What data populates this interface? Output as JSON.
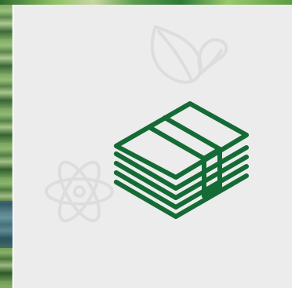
{
  "colors": {
    "primary_icon": "#146b35",
    "faded_icon": "#d6d6d6",
    "panel_background": "#ececec"
  },
  "icons": {
    "primary": "money-stack-icon",
    "background": [
      "leaf-icon",
      "atom-icon"
    ]
  }
}
